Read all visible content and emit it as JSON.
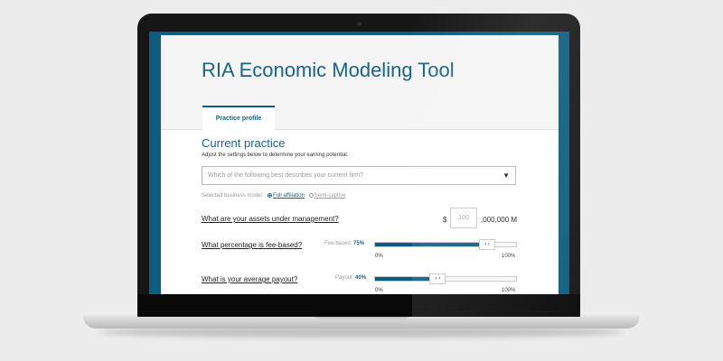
{
  "page_title": "RIA Economic Modeling Tool",
  "tabs": [
    {
      "label": "Practice profile",
      "active": true
    }
  ],
  "section": {
    "title": "Current practice",
    "subtitle": "Adjust the settings below to determine your earning potential."
  },
  "firm_dropdown": {
    "placeholder": "Which of the following best describes your current firm?",
    "caret": "▼"
  },
  "business_model": {
    "label": "Selected business model:",
    "options": [
      {
        "label": "Full affiliation",
        "selected": true
      },
      {
        "label": "Semi-captive",
        "selected": false
      }
    ]
  },
  "questions": {
    "aum": {
      "label": "What are your assets under management?",
      "prefix": "$",
      "placeholder": "100",
      "suffix": ",000,000 M"
    },
    "fee_based": {
      "label": "What percentage is fee-based?",
      "slider_label": "Fee-based:",
      "value_text": "75%",
      "value": 0.75,
      "min_label": "0%",
      "max_label": "100%",
      "knob": "‹ ›"
    },
    "payout": {
      "label": "What is your average payout?",
      "slider_label": "Payout:",
      "value_text": "40%",
      "value": 0.4,
      "min_label": "0%",
      "max_label": "100%",
      "knob": "‹ ›"
    }
  },
  "colors": {
    "brand": "#0d5d7d",
    "title_text": "#1b6386",
    "background": "#ececec"
  }
}
